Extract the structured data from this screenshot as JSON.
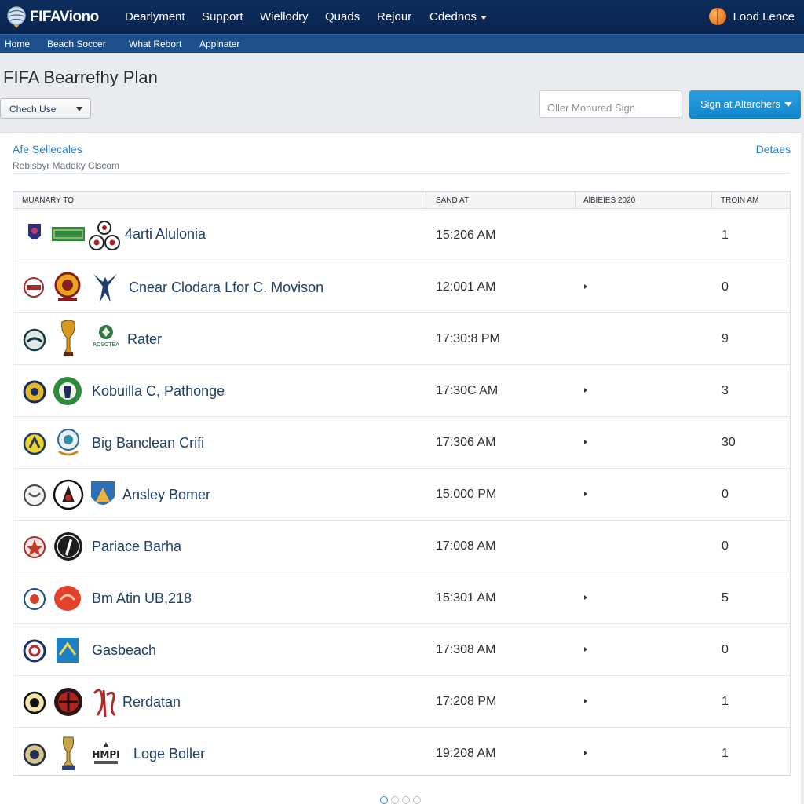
{
  "topbar": {
    "logo_text": "FIFAViono",
    "nav": [
      "Dearlyment",
      "Support",
      "Wiellodry",
      "Quads",
      "Rejour",
      "Cdednos"
    ],
    "login_label": "Lood Lence"
  },
  "subnav": [
    "Home",
    "Beach Soccer",
    "What Rebort",
    "Applnater"
  ],
  "page": {
    "title": "FIFA Bearrefhy Plan",
    "select_value": "Chech Use",
    "search_placeholder": "Oller Monured Sign",
    "sign_button": "Sign at Altarchers"
  },
  "panel": {
    "heading": "Afe Sellecales",
    "subheading": "Rebisbyr Maddky Clscom",
    "details_link": "Detaes"
  },
  "table": {
    "columns": [
      "MUANARY TO",
      "SAND AT",
      "AlBIEIES 2020",
      "TROIN AM"
    ],
    "rows": [
      {
        "name": "4arti Alulonia",
        "time": "15:206 AM",
        "arrow": false,
        "count": "1"
      },
      {
        "name": "Cnear Clodara Lfor C. Movison",
        "time": "12:001 AM",
        "arrow": true,
        "count": "0"
      },
      {
        "name": "Rater",
        "time": "17:30:8 PM",
        "arrow": false,
        "count": "9"
      },
      {
        "name": "Kobuilla C, Pathonge",
        "time": "17:30C AM",
        "arrow": true,
        "count": "3"
      },
      {
        "name": "Big Banclean Crifi",
        "time": "17:306 AM",
        "arrow": true,
        "count": "30"
      },
      {
        "name": "Ansley Bomer",
        "time": "15:000 PM",
        "arrow": true,
        "count": "0"
      },
      {
        "name": "Pariace Barha",
        "time": "17:008 AM",
        "arrow": false,
        "count": "0"
      },
      {
        "name": "Bm Atin UB,218",
        "time": "15:301 AM",
        "arrow": true,
        "count": "5"
      },
      {
        "name": "Gasbeach",
        "time": "17:308 AM",
        "arrow": true,
        "count": "0"
      },
      {
        "name": "Rerdatan",
        "time": "17:208 PM",
        "arrow": true,
        "count": "1"
      },
      {
        "name": "Loge Boller",
        "time": "19:208 AM",
        "arrow": true,
        "count": "1"
      }
    ]
  },
  "badge_text": {
    "row3_emblem": "ROSOTEA",
    "row11_emblem": "HMPI"
  },
  "colors": {
    "topbar": "#0c2d5b",
    "subbar": "#1d4f8a",
    "accent": "#2a7fbf",
    "button": "#1a8fd6"
  }
}
